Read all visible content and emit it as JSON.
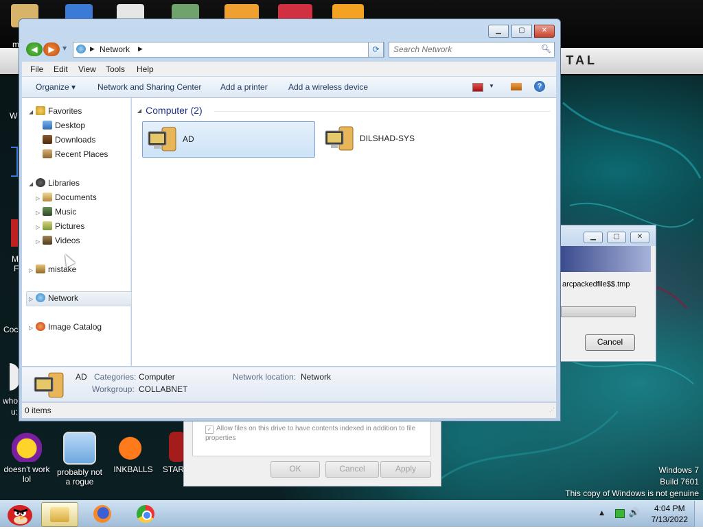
{
  "desktop": {
    "brand_text": "TAL",
    "icons": [
      {
        "label": "doesn't work lol"
      },
      {
        "label": "probably not a rogue"
      },
      {
        "label": "INKBALLS"
      },
      {
        "label": "STAR"
      }
    ],
    "left_stubs": [
      "m",
      "W",
      "M",
      "F",
      "Coc",
      "who",
      "u:"
    ],
    "watermark": {
      "line1": "Windows 7",
      "line2": "Build 7601",
      "line3": "This copy of Windows is not genuine"
    }
  },
  "taskbar": {
    "clock_time": "4:04 PM",
    "clock_date": "7/13/2022",
    "tray_arrow": "▲",
    "tray_volume": "🔊"
  },
  "copy_dialog": {
    "filename": "arcpackedfile$$.tmp",
    "cancel_label": "Cancel",
    "progress": 0.0
  },
  "props_dialog": {
    "checkbox_label": "Allow files on this drive to have contents indexed in addition to file properties",
    "ok_label": "OK",
    "cancel_label": "Cancel",
    "apply_label": "Apply"
  },
  "explorer": {
    "address": "Network",
    "search_placeholder": "Search Network",
    "menu": [
      "File",
      "Edit",
      "View",
      "Tools",
      "Help"
    ],
    "commands": {
      "organize": "Organize ▾",
      "network_sharing": "Network and Sharing Center",
      "add_printer": "Add a printer",
      "add_wireless": "Add a wireless device"
    },
    "nav": {
      "favorites": "Favorites",
      "desktop": "Desktop",
      "downloads": "Downloads",
      "recent_places": "Recent Places",
      "libraries": "Libraries",
      "documents": "Documents",
      "music": "Music",
      "pictures": "Pictures",
      "videos": "Videos",
      "mistake": "mistake",
      "network": "Network",
      "image_catalog": "Image Catalog"
    },
    "group_header": "Computer (2)",
    "computers": [
      {
        "name": "AD"
      },
      {
        "name": "DILSHAD-SYS"
      }
    ],
    "details": {
      "name": "AD",
      "categories_key": "Categories:",
      "categories_val": "Computer",
      "workgroup_key": "Workgroup:",
      "workgroup_val": "COLLABNET",
      "location_key": "Network location:",
      "location_val": "Network"
    },
    "status": "0 items"
  },
  "colors": {
    "accent": "#1e3287",
    "selection": "#cde3f8",
    "taskbar": "#b7cde6"
  }
}
